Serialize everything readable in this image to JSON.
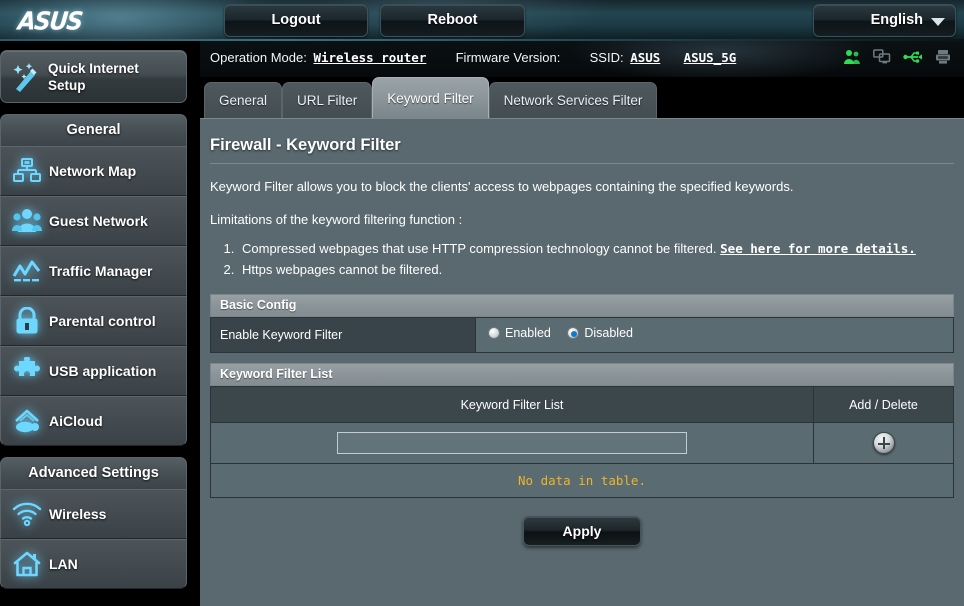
{
  "header": {
    "logo": "ASUS",
    "logout_label": "Logout",
    "reboot_label": "Reboot",
    "language": "English"
  },
  "infostrip": {
    "operation_mode_label": "Operation Mode:",
    "operation_mode_value": "Wireless router",
    "firmware_label": "Firmware Version:",
    "firmware_value": "",
    "ssid_label": "SSID:",
    "ssid_1": "ASUS",
    "ssid_2": "ASUS_5G",
    "icons": [
      {
        "name": "guest-users-icon",
        "color": "#2fdc55"
      },
      {
        "name": "clients-monitors-icon",
        "color": "#6e7a80"
      },
      {
        "name": "usb-icon",
        "color": "#2fdc55"
      },
      {
        "name": "printer-server-icon",
        "color": "#6e7a80"
      }
    ]
  },
  "sidebar": {
    "quick_setup": {
      "line1": "Quick Internet",
      "line2": "Setup",
      "icon": "magic-wand-icon"
    },
    "groups": [
      {
        "title": "General",
        "items": [
          {
            "label": "Network Map",
            "icon": "network-map-icon"
          },
          {
            "label": "Guest Network",
            "icon": "guest-network-icon"
          },
          {
            "label": "Traffic Manager",
            "icon": "traffic-manager-icon"
          },
          {
            "label": "Parental control",
            "icon": "lock-icon"
          },
          {
            "label": "USB application",
            "icon": "puzzle-icon"
          },
          {
            "label": "AiCloud",
            "icon": "aicloud-icon"
          }
        ]
      },
      {
        "title": "Advanced Settings",
        "items": [
          {
            "label": "Wireless",
            "icon": "wifi-icon"
          },
          {
            "label": "LAN",
            "icon": "home-icon"
          }
        ]
      }
    ]
  },
  "tabs": [
    {
      "label": "General",
      "active": false
    },
    {
      "label": "URL Filter",
      "active": false
    },
    {
      "label": "Keyword Filter",
      "active": true
    },
    {
      "label": "Network Services Filter",
      "active": false
    }
  ],
  "main": {
    "page_title": "Firewall - Keyword Filter",
    "description": "Keyword Filter allows you to block the clients' access to webpages containing the specified keywords.",
    "limitations_intro": "Limitations of the keyword filtering function :",
    "limitation_1_text": "Compressed webpages that use HTTP compression technology cannot be filtered.",
    "limitation_1_link": "See here for more details.",
    "limitation_2_text": "Https webpages cannot be filtered.",
    "basic_config": {
      "section_title": "Basic Config",
      "enable_label": "Enable Keyword Filter",
      "options": [
        {
          "label": "Enabled",
          "checked": false
        },
        {
          "label": "Disabled",
          "checked": true
        }
      ]
    },
    "keyword_list": {
      "section_title": "Keyword Filter List",
      "col_keyword": "Keyword Filter List",
      "col_action": "Add / Delete",
      "input_value": "",
      "input_placeholder": "",
      "add_icon": "plus-circle-icon",
      "empty_message": "No data in table."
    },
    "apply_label": "Apply"
  },
  "colors": {
    "panel_bg": "#59696f",
    "section_head": "#8b9499",
    "table_head": "#3c474c",
    "label_cell": "#39444a",
    "value_cell": "#5a6b71",
    "accent_cyan": "#6ed7ff",
    "warning_text": "#f0b429",
    "radio_blue": "#1577c8"
  }
}
